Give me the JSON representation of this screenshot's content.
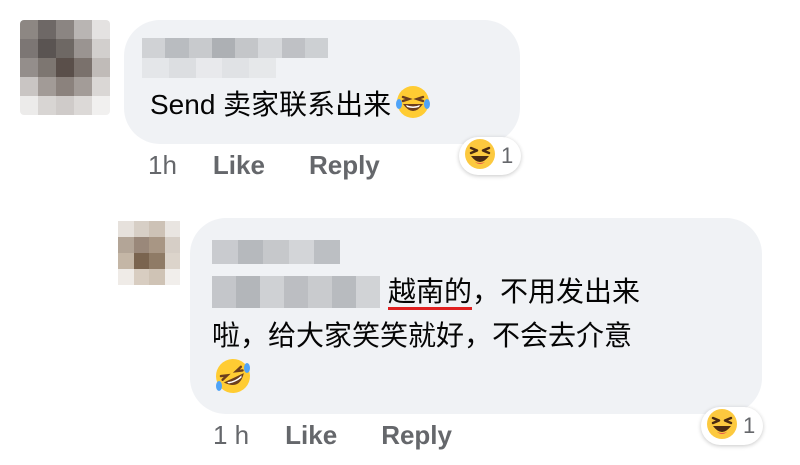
{
  "comments": [
    {
      "message": "Send 卖家联系出来",
      "reaction_emoji": "laughing-tears",
      "time": "1h",
      "like_label": "Like",
      "reply_label": "Reply",
      "reaction_icon": "laughing-squint-icon",
      "reaction_count": "1"
    },
    {
      "message_part1_underlined": "越南的",
      "message_part1_rest": "，不用发出来",
      "message_part2": "啦，给大家笑笑就好，不会去介意",
      "message_emoji": "rofl",
      "time": "1 h",
      "like_label": "Like",
      "reply_label": "Reply",
      "reaction_icon": "laughing-squint-icon",
      "reaction_count": "1"
    }
  ],
  "colors": {
    "bubble_bg": "#f0f2f5",
    "text": "#050505",
    "meta": "#65676b",
    "underline": "#e02020"
  }
}
